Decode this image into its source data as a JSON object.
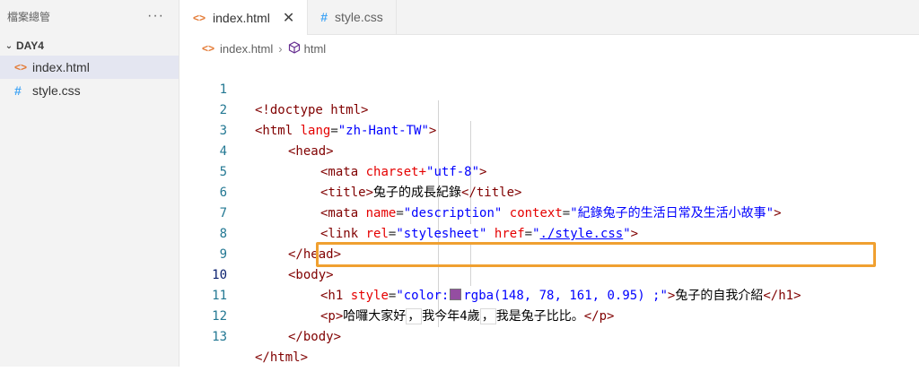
{
  "sidebar": {
    "title": "檔案總管",
    "more": "···",
    "folder": "DAY4",
    "files": [
      {
        "name": "index.html",
        "icon": "html-file-icon",
        "active": true
      },
      {
        "name": "style.css",
        "icon": "css-file-icon",
        "active": false
      }
    ]
  },
  "tabs": [
    {
      "label": "index.html",
      "icon": "html-file-icon",
      "active": true,
      "close": "✕"
    },
    {
      "label": "style.css",
      "icon": "css-file-icon",
      "active": false
    }
  ],
  "breadcrumb": {
    "file": "index.html",
    "symbol": "html"
  },
  "editor": {
    "line_numbers": [
      "1",
      "2",
      "3",
      "4",
      "5",
      "6",
      "7",
      "8",
      "9",
      "10",
      "11",
      "12",
      "13"
    ],
    "current_line": 10,
    "colors": {
      "tag": "#800000",
      "attribute": "#e50000",
      "value": "#0000ff",
      "line_number": "#237893",
      "highlight_border": "#f0a030",
      "swatch": "#944ea1"
    },
    "code": {
      "l1_open": "<!doctype html>",
      "l2_tag": "<html",
      "l2_attr": "lang",
      "l2_eq": "=",
      "l2_val": "\"zh-Hant-TW\"",
      "l2_close": ">",
      "l3": "<head>",
      "l4_tag": "<mata",
      "l4_attr": "charset+",
      "l4_val": "\"utf-8\"",
      "l4_close": ">",
      "l5_open": "<title>",
      "l5_text": "兔子的成長紀錄",
      "l5_close": "</title>",
      "l6_tag": "<mata",
      "l6_attr1": "name",
      "l6_val1": "\"description\"",
      "l6_attr2": "context",
      "l6_val2": "\"紀錄兔子的生活日常及生活小故事\"",
      "l6_close": ">",
      "l7_tag": "<link",
      "l7_attr1": "rel",
      "l7_val1": "\"stylesheet\"",
      "l7_attr2": "href",
      "l7_q1": "\"",
      "l7_link": "./style.css",
      "l7_q2": "\"",
      "l7_close": ">",
      "l8": "</head>",
      "l9": "<body>",
      "l10_tag": "<h1",
      "l10_attr": "style",
      "l10_val_a": "\"color:",
      "l10_val_b": "rgba(148, 78, 161, 0.95) ;\"",
      "l10_gt": ">",
      "l10_text": "兔子的自我介紹",
      "l10_close": "</h1>",
      "l11_open": "<p>",
      "l11_t1": "哈囉大家好",
      "l11_c1": "，",
      "l11_t2": "我今年4歲",
      "l11_c2": "，",
      "l11_t3": "我是兔子比比。",
      "l11_close": "</p>",
      "l12": "</body>",
      "l13": "</html>"
    }
  }
}
